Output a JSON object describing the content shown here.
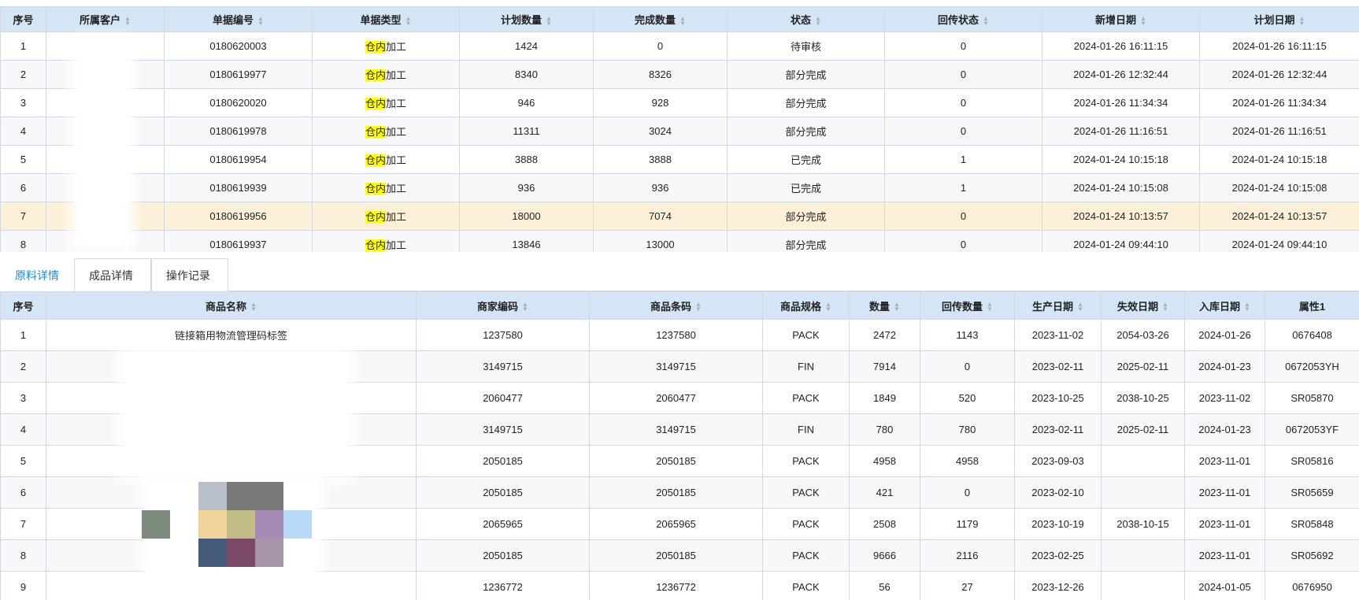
{
  "top_table": {
    "columns": [
      "序号",
      "所属客户",
      "单据编号",
      "单据类型",
      "计划数量",
      "完成数量",
      "状态",
      "回传状态",
      "新增日期",
      "计划日期"
    ],
    "doc_type_highlight": "仓内",
    "doc_type_rest": "加工",
    "rows": [
      {
        "no": "1",
        "customer": "",
        "doc_no": "0180620003",
        "plan_qty": "1424",
        "done_qty": "0",
        "status": "待审核",
        "return_status": "0",
        "add_date": "2024-01-26 16:11:15",
        "plan_date": "2024-01-26 16:11:15"
      },
      {
        "no": "2",
        "customer": "",
        "doc_no": "0180619977",
        "plan_qty": "8340",
        "done_qty": "8326",
        "status": "部分完成",
        "return_status": "0",
        "add_date": "2024-01-26 12:32:44",
        "plan_date": "2024-01-26 12:32:44"
      },
      {
        "no": "3",
        "customer": "",
        "doc_no": "0180620020",
        "plan_qty": "946",
        "done_qty": "928",
        "status": "部分完成",
        "return_status": "0",
        "add_date": "2024-01-26 11:34:34",
        "plan_date": "2024-01-26 11:34:34"
      },
      {
        "no": "4",
        "customer": "",
        "doc_no": "0180619978",
        "plan_qty": "11311",
        "done_qty": "3024",
        "status": "部分完成",
        "return_status": "0",
        "add_date": "2024-01-26 11:16:51",
        "plan_date": "2024-01-26 11:16:51"
      },
      {
        "no": "5",
        "customer": "",
        "doc_no": "0180619954",
        "plan_qty": "3888",
        "done_qty": "3888",
        "status": "已完成",
        "return_status": "1",
        "add_date": "2024-01-24 10:15:18",
        "plan_date": "2024-01-24 10:15:18"
      },
      {
        "no": "6",
        "customer": "",
        "doc_no": "0180619939",
        "plan_qty": "936",
        "done_qty": "936",
        "status": "已完成",
        "return_status": "1",
        "add_date": "2024-01-24 10:15:08",
        "plan_date": "2024-01-24 10:15:08"
      },
      {
        "no": "7",
        "customer": "",
        "doc_no": "0180619956",
        "plan_qty": "18000",
        "done_qty": "7074",
        "status": "部分完成",
        "return_status": "0",
        "add_date": "2024-01-24 10:13:57",
        "plan_date": "2024-01-24 10:13:57"
      },
      {
        "no": "8",
        "customer": "",
        "doc_no": "0180619937",
        "plan_qty": "13846",
        "done_qty": "13000",
        "status": "部分完成",
        "return_status": "0",
        "add_date": "2024-01-24 09:44:10",
        "plan_date": "2024-01-24 09:44:10"
      }
    ]
  },
  "tabs": [
    "原料详情",
    "成品详情",
    "操作记录"
  ],
  "bottom_table": {
    "columns": [
      "序号",
      "商品名称",
      "商家编码",
      "商品条码",
      "商品规格",
      "数量",
      "回传数量",
      "生产日期",
      "失效日期",
      "入库日期",
      "属性1"
    ],
    "rows": [
      {
        "no": "1",
        "name": "链接箱用物流管理码标签",
        "merchant_code": "1237580",
        "barcode": "1237580",
        "spec": "PACK",
        "qty": "2472",
        "return_qty": "1143",
        "prod_date": "2023-11-02",
        "exp_date": "2054-03-26",
        "in_date": "2024-01-26",
        "attr1": "0676408"
      },
      {
        "no": "2",
        "name": "",
        "merchant_code": "3149715",
        "barcode": "3149715",
        "spec": "FIN",
        "qty": "7914",
        "return_qty": "0",
        "prod_date": "2023-02-11",
        "exp_date": "2025-02-11",
        "in_date": "2024-01-23",
        "attr1": "0672053YH"
      },
      {
        "no": "3",
        "name": "",
        "merchant_code": "2060477",
        "barcode": "2060477",
        "spec": "PACK",
        "qty": "1849",
        "return_qty": "520",
        "prod_date": "2023-10-25",
        "exp_date": "2038-10-25",
        "in_date": "2023-11-02",
        "attr1": "SR05870"
      },
      {
        "no": "4",
        "name": "",
        "merchant_code": "3149715",
        "barcode": "3149715",
        "spec": "FIN",
        "qty": "780",
        "return_qty": "780",
        "prod_date": "2023-02-11",
        "exp_date": "2025-02-11",
        "in_date": "2024-01-23",
        "attr1": "0672053YF"
      },
      {
        "no": "5",
        "name": "",
        "merchant_code": "2050185",
        "barcode": "2050185",
        "spec": "PACK",
        "qty": "4958",
        "return_qty": "4958",
        "prod_date": "2023-09-03",
        "exp_date": "",
        "in_date": "2023-11-01",
        "attr1": "SR05816"
      },
      {
        "no": "6",
        "name": "",
        "merchant_code": "2050185",
        "barcode": "2050185",
        "spec": "PACK",
        "qty": "421",
        "return_qty": "0",
        "prod_date": "2023-02-10",
        "exp_date": "",
        "in_date": "2023-11-01",
        "attr1": "SR05659"
      },
      {
        "no": "7",
        "name": "",
        "merchant_code": "2065965",
        "barcode": "2065965",
        "spec": "PACK",
        "qty": "2508",
        "return_qty": "1179",
        "prod_date": "2023-10-19",
        "exp_date": "2038-10-15",
        "in_date": "2023-11-01",
        "attr1": "SR05848"
      },
      {
        "no": "8",
        "name": "",
        "merchant_code": "2050185",
        "barcode": "2050185",
        "spec": "PACK",
        "qty": "9666",
        "return_qty": "2116",
        "prod_date": "2023-02-25",
        "exp_date": "",
        "in_date": "2023-11-01",
        "attr1": "SR05692"
      },
      {
        "no": "9",
        "name": "",
        "merchant_code": "1236772",
        "barcode": "1236772",
        "spec": "PACK",
        "qty": "56",
        "return_qty": "27",
        "prod_date": "2023-12-26",
        "exp_date": "",
        "in_date": "2024-01-05",
        "attr1": "0676950"
      }
    ]
  },
  "colors": {
    "header_bg": "#d4e6f6",
    "border": "#cfd8e3",
    "selected_row": "#fdf0d8",
    "stripe": "#f7f8fa",
    "highlight": "#ffff00",
    "active_tab": "#1e86e0"
  },
  "icons": {
    "sort": "sort-arrows-icon"
  }
}
